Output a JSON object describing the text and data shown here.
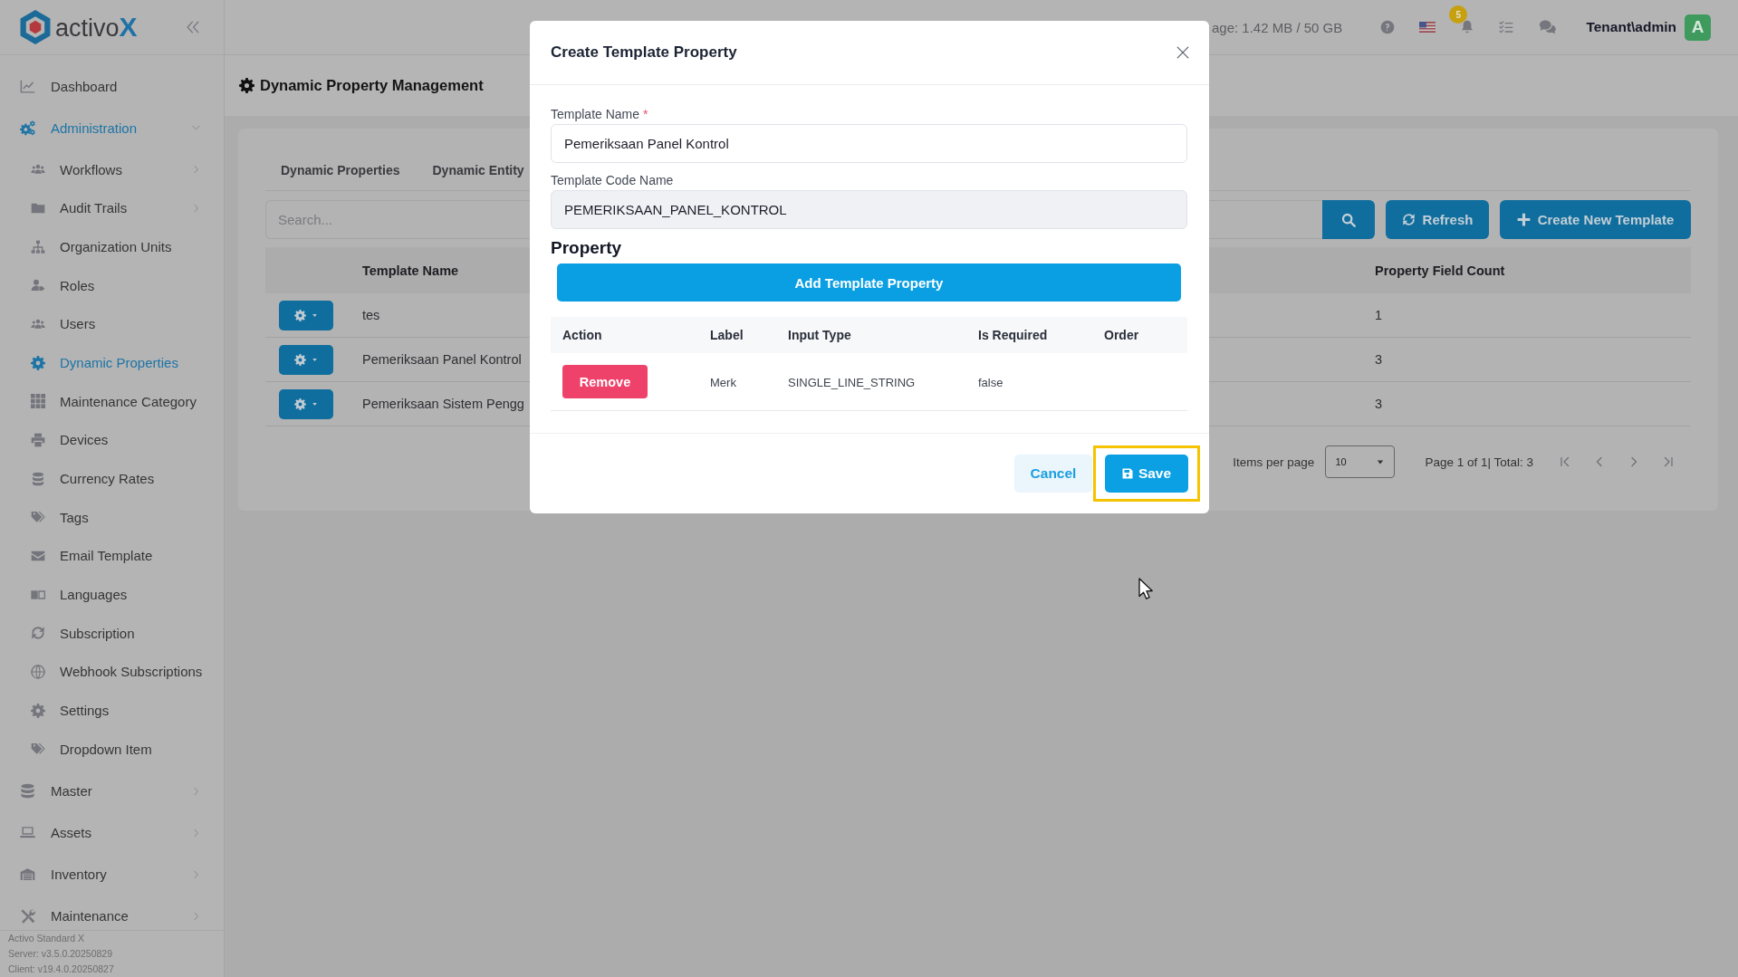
{
  "sidebar": {
    "logo": {
      "name": "activo",
      "mark": "X"
    },
    "items": [
      {
        "label": "Dashboard",
        "selected": false
      },
      {
        "label": "Administration",
        "selected": true,
        "expanded": true,
        "children": [
          {
            "label": "Workflows",
            "selected": false,
            "expanded": false
          },
          {
            "label": "Audit Trails",
            "selected": false,
            "expanded": false
          },
          {
            "label": "Organization Units",
            "selected": false
          },
          {
            "label": "Roles",
            "selected": false
          },
          {
            "label": "Users",
            "selected": false
          },
          {
            "label": "Dynamic Properties",
            "selected": true
          },
          {
            "label": "Maintenance Category",
            "selected": false
          },
          {
            "label": "Devices",
            "selected": false
          },
          {
            "label": "Currency Rates",
            "selected": false
          },
          {
            "label": "Tags",
            "selected": false
          },
          {
            "label": "Email Template",
            "selected": false
          },
          {
            "label": "Languages",
            "selected": false
          },
          {
            "label": "Subscription",
            "selected": false
          },
          {
            "label": "Webhook Subscriptions",
            "selected": false
          },
          {
            "label": "Settings",
            "selected": false
          },
          {
            "label": "Dropdown Item",
            "selected": false
          }
        ]
      },
      {
        "label": "Master",
        "selected": false,
        "expanded": false
      },
      {
        "label": "Assets",
        "selected": false,
        "expanded": false
      },
      {
        "label": "Inventory",
        "selected": false,
        "expanded": false
      },
      {
        "label": "Maintenance",
        "selected": false,
        "expanded": false
      }
    ],
    "footer": [
      "Activo Standard X",
      "Server: v3.5.0.20250829",
      "Client: v19.4.0.20250827"
    ]
  },
  "topbar": {
    "storage": "age: 1.42 MB / 50 GB",
    "notification_count": "5",
    "user": "Tenant\\admin",
    "avatar": "A"
  },
  "page": {
    "title": "Dynamic Property Management",
    "tabs": [
      {
        "label": "Dynamic Properties"
      },
      {
        "label": "Dynamic Entity"
      }
    ],
    "search": {
      "placeholder": "Search..."
    },
    "actions": [
      {
        "kind": "search"
      },
      {
        "kind": "refresh",
        "label": "Refresh"
      },
      {
        "kind": "create",
        "label": "Create New Template"
      }
    ],
    "table": {
      "columns": [
        "Template Name",
        "Property Field Count"
      ],
      "rows": [
        {
          "name": "tes",
          "field_count": "1"
        },
        {
          "name": "Pemeriksaan Panel Kontrol",
          "field_count": "3"
        },
        {
          "name": "Pemeriksaan Sistem Pengg",
          "field_count": "3"
        }
      ]
    },
    "pagination": {
      "label": "Items per page",
      "page_size": "10",
      "summary": "Page 1 of 1| Total: 3"
    }
  },
  "modal": {
    "title": "Create Template Property",
    "fields": [
      {
        "label": "Template Name",
        "required_mark": "*",
        "value": "Pemeriksaan Panel Kontrol",
        "disabled": false
      },
      {
        "label": "Template Code Name",
        "value": "PEMERIKSAAN_PANEL_KONTROL",
        "disabled": true
      }
    ],
    "section": "Property",
    "add_button": "Add Template Property",
    "table": {
      "columns": [
        "Action",
        "Label",
        "Input Type",
        "Is Required",
        "Order"
      ],
      "rows": [
        {
          "action": "Remove",
          "label": "Merk",
          "input_type": "SINGLE_LINE_STRING",
          "is_required": "false"
        }
      ]
    },
    "buttons": [
      {
        "kind": "cancel",
        "label": "Cancel",
        "highlighted": false
      },
      {
        "kind": "save",
        "label": "Save",
        "highlighted": true
      }
    ]
  }
}
